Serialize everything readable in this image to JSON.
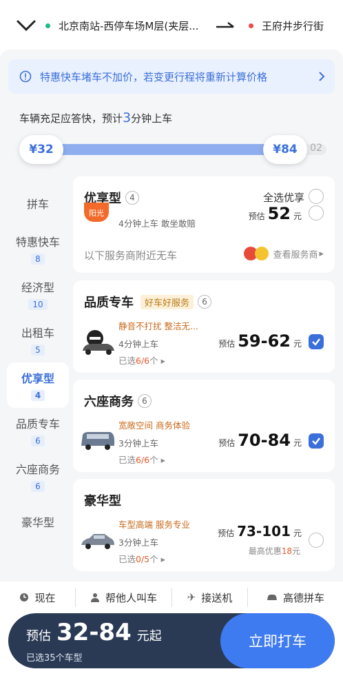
{
  "route": {
    "from": "北京南站-西停车场M层(夹层...",
    "to": "王府井步行街"
  },
  "notice": {
    "text": "特惠快车堵车不加价，若变更行程将重新计算价格"
  },
  "eta": {
    "prefix": "车辆充足应答快，预计",
    "minutes": "3",
    "suffix": "分钟上车"
  },
  "slider": {
    "min_label": "¥32",
    "max_label": "¥84",
    "tail": "02"
  },
  "categories": [
    {
      "label": "拼车",
      "count": ""
    },
    {
      "label": "特惠快车",
      "count": "8"
    },
    {
      "label": "经济型",
      "count": "10"
    },
    {
      "label": "出租车",
      "count": "5"
    },
    {
      "label": "优享型",
      "count": "4"
    },
    {
      "label": "品质专车",
      "count": "6"
    },
    {
      "label": "六座商务",
      "count": "6"
    },
    {
      "label": "豪华型",
      "count": ""
    }
  ],
  "cards": {
    "youxiang": {
      "title": "优享型",
      "count": "4",
      "select_all": "全选优享",
      "logo": "阳光",
      "mins": "4分钟上车 敢坐敢赔",
      "price_prefix": "预估",
      "price": "52",
      "unit": "元",
      "no_car": "以下服务商附近无车",
      "view": "查看服务商"
    },
    "pinzhi": {
      "title": "品质专车",
      "tag": "好车好服务",
      "count": "6",
      "feat": "静音不打扰 整洁无...",
      "mins": "4分钟上车",
      "sel_prefix": "已选",
      "sel_num": "6/6",
      "sel_suffix": "个",
      "price_prefix": "预估",
      "price": "59-62",
      "unit": "元"
    },
    "liuzuo": {
      "title": "六座商务",
      "count": "6",
      "feat": "宽敞空间 商务体验",
      "mins": "3分钟上车",
      "sel_prefix": "已选",
      "sel_num": "6/6",
      "sel_suffix": "个",
      "price_prefix": "预估",
      "price": "70-84",
      "unit": "元"
    },
    "haohua": {
      "title": "豪华型",
      "feat": "车型高端 服务专业",
      "mins": "3分钟上车",
      "sel_prefix": "已选",
      "sel_num": "0/5",
      "sel_suffix": "个",
      "price_prefix": "预估",
      "price": "73-101",
      "unit": "元",
      "discount_prefix": "最高优惠",
      "discount": "18",
      "discount_unit": "元"
    }
  },
  "bottom_tabs": [
    {
      "label": "现在",
      "icon": "clock-icon"
    },
    {
      "label": "帮他人叫车",
      "icon": "person-icon"
    },
    {
      "label": "接送机",
      "icon": "plane-icon"
    },
    {
      "label": "高德拼车",
      "icon": "carpool-icon"
    }
  ],
  "cta": {
    "prefix": "预估",
    "price": "32-84",
    "suffix": "元起",
    "sub": "已选35个车型",
    "button": "立即打车"
  },
  "colors": {
    "accent": "#3b6fd9",
    "orange": "#e8572a",
    "cta_bg": "#2a3a55",
    "button": "#3f7bf0"
  }
}
